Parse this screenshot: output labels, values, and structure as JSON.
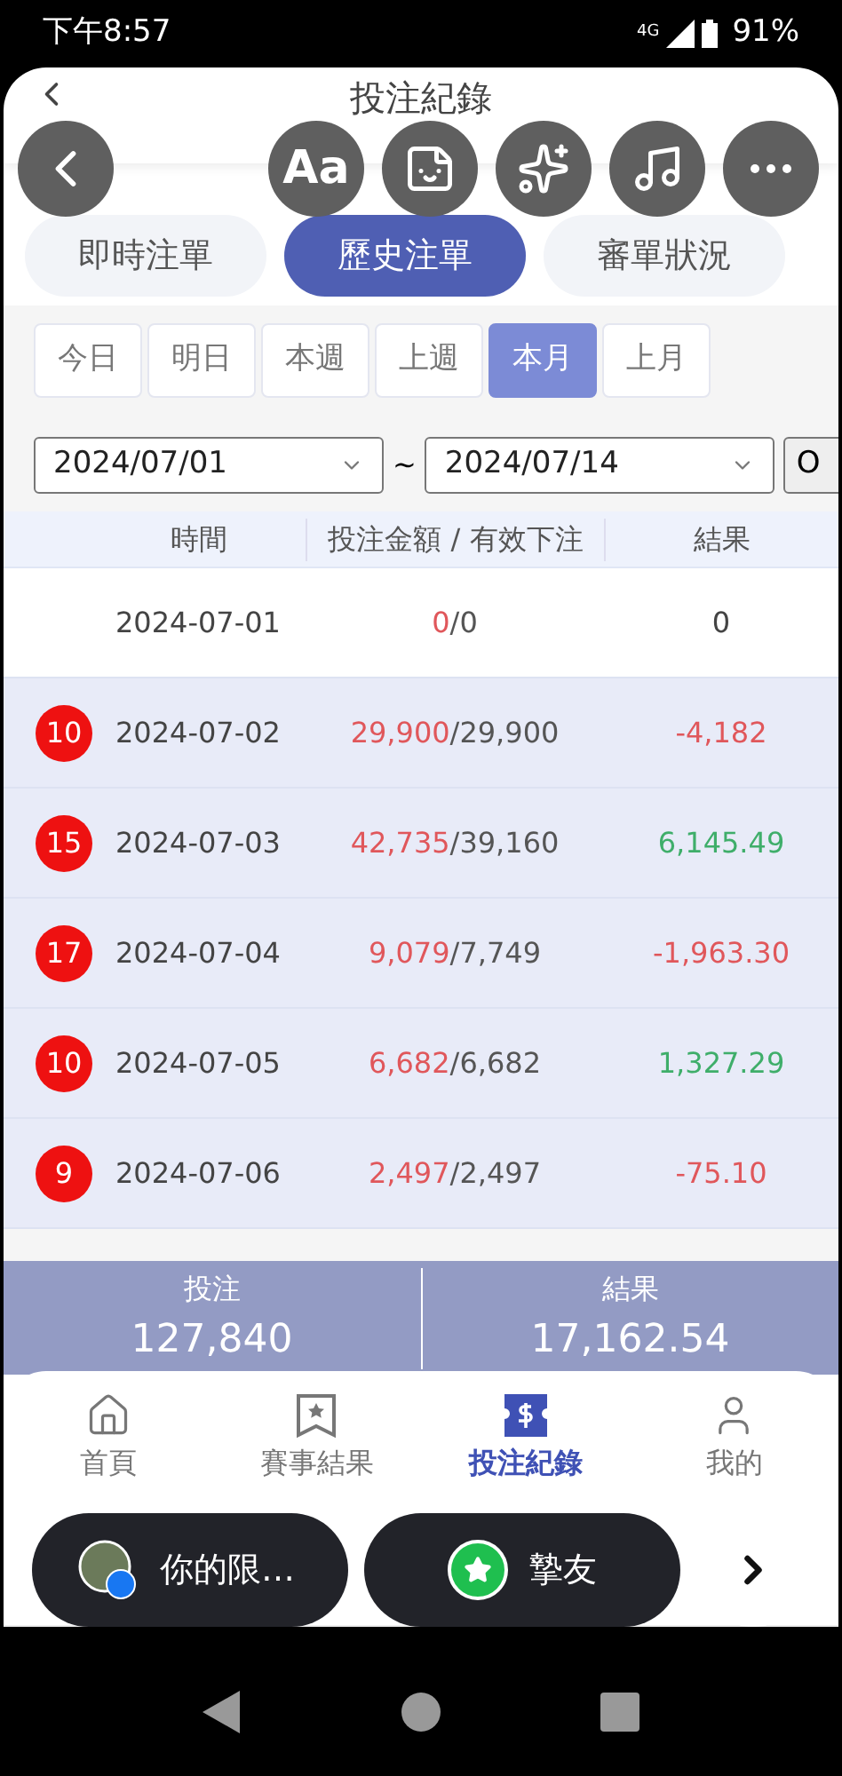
{
  "status_bar": {
    "time": "下午8:57",
    "battery": "91%",
    "network": "4G"
  },
  "header": {
    "title": "投注紀錄"
  },
  "overlay_buttons": [
    {
      "kind": "back"
    },
    {
      "kind": "text",
      "label": "Aa"
    },
    {
      "kind": "sticker"
    },
    {
      "kind": "sparkle"
    },
    {
      "kind": "music"
    },
    {
      "kind": "more"
    }
  ],
  "tabs": [
    {
      "label": "即時注單",
      "selected": false
    },
    {
      "label": "歷史注單",
      "selected": true
    },
    {
      "label": "審單狀況",
      "selected": false
    }
  ],
  "periods": [
    {
      "label": "今日",
      "selected": false
    },
    {
      "label": "明日",
      "selected": false
    },
    {
      "label": "本週",
      "selected": false
    },
    {
      "label": "上週",
      "selected": false
    },
    {
      "label": "本月",
      "selected": true
    },
    {
      "label": "上月",
      "selected": false
    }
  ],
  "date_range": {
    "from": "2024/07/01",
    "separator": "~",
    "to": "2024/07/14",
    "ok": "O"
  },
  "table": {
    "columns": [
      "時間",
      "投注金額 / 有效下注",
      "結果"
    ],
    "rows": [
      {
        "count": "",
        "date": "2024-07-01",
        "bet": "0",
        "valid": "/0",
        "result": "0",
        "kind": "even",
        "highlighted": false
      },
      {
        "count": "10",
        "date": "2024-07-02",
        "bet": "29,900",
        "valid": "/29,900",
        "result": "-4,182",
        "kind": "loss",
        "highlighted": true
      },
      {
        "count": "15",
        "date": "2024-07-03",
        "bet": "42,735",
        "valid": "/39,160",
        "result": "6,145.49",
        "kind": "win",
        "highlighted": true
      },
      {
        "count": "17",
        "date": "2024-07-04",
        "bet": "9,079",
        "valid": "/7,749",
        "result": "-1,963.30",
        "kind": "loss",
        "highlighted": true
      },
      {
        "count": "10",
        "date": "2024-07-05",
        "bet": "6,682",
        "valid": "/6,682",
        "result": "1,327.29",
        "kind": "win",
        "highlighted": true
      },
      {
        "count": "9",
        "date": "2024-07-06",
        "bet": "2,497",
        "valid": "/2,497",
        "result": "-75.10",
        "kind": "loss",
        "highlighted": true
      }
    ]
  },
  "summary": [
    {
      "label": "投注",
      "value": "127,840"
    },
    {
      "label": "結果",
      "value": "17,162.54"
    }
  ],
  "bottom_nav": [
    {
      "kind": "home",
      "label": "首頁",
      "selected": false
    },
    {
      "kind": "results",
      "label": "賽事結果",
      "selected": false
    },
    {
      "kind": "bets",
      "label": "投注紀錄",
      "selected": true
    },
    {
      "kind": "profile",
      "label": "我的",
      "selected": false
    }
  ],
  "chat_bubbles": [
    {
      "kind": "story",
      "label": "你的限…"
    },
    {
      "kind": "friends",
      "label": "摯友"
    },
    {
      "kind": "next"
    }
  ]
}
